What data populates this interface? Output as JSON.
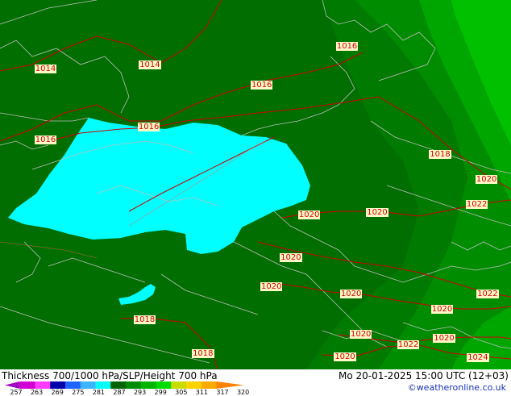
{
  "map": {
    "pressure_labels": [
      {
        "text": "1014",
        "x_pct": 8.8,
        "y_pct": 18.8
      },
      {
        "text": "1014",
        "x_pct": 29.2,
        "y_pct": 17.7
      },
      {
        "text": "1016",
        "x_pct": 67.8,
        "y_pct": 12.7
      },
      {
        "text": "1016",
        "x_pct": 51.1,
        "y_pct": 23.2
      },
      {
        "text": "1016",
        "x_pct": 29.0,
        "y_pct": 34.5
      },
      {
        "text": "1016",
        "x_pct": 8.8,
        "y_pct": 38.0
      },
      {
        "text": "1018",
        "x_pct": 86.0,
        "y_pct": 41.9
      },
      {
        "text": "1020",
        "x_pct": 95.1,
        "y_pct": 48.7
      },
      {
        "text": "1020",
        "x_pct": 60.4,
        "y_pct": 58.3
      },
      {
        "text": "1020",
        "x_pct": 73.7,
        "y_pct": 57.6
      },
      {
        "text": "1022",
        "x_pct": 93.2,
        "y_pct": 55.5
      },
      {
        "text": "1020",
        "x_pct": 56.8,
        "y_pct": 69.8
      },
      {
        "text": "1020",
        "x_pct": 53.0,
        "y_pct": 77.7
      },
      {
        "text": "1020",
        "x_pct": 68.6,
        "y_pct": 79.7
      },
      {
        "text": "1022",
        "x_pct": 95.3,
        "y_pct": 79.7
      },
      {
        "text": "1020",
        "x_pct": 86.4,
        "y_pct": 83.8
      },
      {
        "text": "1018",
        "x_pct": 28.2,
        "y_pct": 86.7
      },
      {
        "text": "1020",
        "x_pct": 70.5,
        "y_pct": 90.6
      },
      {
        "text": "1020",
        "x_pct": 86.8,
        "y_pct": 91.7
      },
      {
        "text": "1022",
        "x_pct": 79.8,
        "y_pct": 93.4
      },
      {
        "text": "1018",
        "x_pct": 39.6,
        "y_pct": 95.9
      },
      {
        "text": "1020",
        "x_pct": 67.4,
        "y_pct": 96.7
      },
      {
        "text": "1024",
        "x_pct": 93.4,
        "y_pct": 96.9
      }
    ]
  },
  "caption": {
    "title": "Thickness 700/1000 hPa/SLP/Height 700 hPa",
    "datetime": "Mo 20-01-2025 15:00 UTC (12+03)",
    "credit": "©weatheronline.co.uk"
  },
  "legend": {
    "ticks": [
      "257",
      "263",
      "269",
      "275",
      "281",
      "287",
      "293",
      "299",
      "305",
      "311",
      "317",
      "320"
    ],
    "colors": [
      "#a400c8",
      "#d200d2",
      "#ff3cff",
      "#0000aa",
      "#1e64ff",
      "#3cb4ff",
      "#00ffff",
      "#006400",
      "#008c00",
      "#00b400",
      "#00dc00",
      "#c8dc00",
      "#ffd200",
      "#ffaa00",
      "#ff8200"
    ]
  },
  "colors": {
    "land_dark": "#006e00",
    "land_mid": "#008200",
    "land_light": "#00a000",
    "land_bright": "#00c800",
    "cold_pool": "#00ffff",
    "isobar": "#d20000",
    "border": "#bebebe",
    "label_bg": "#fff9c8"
  }
}
